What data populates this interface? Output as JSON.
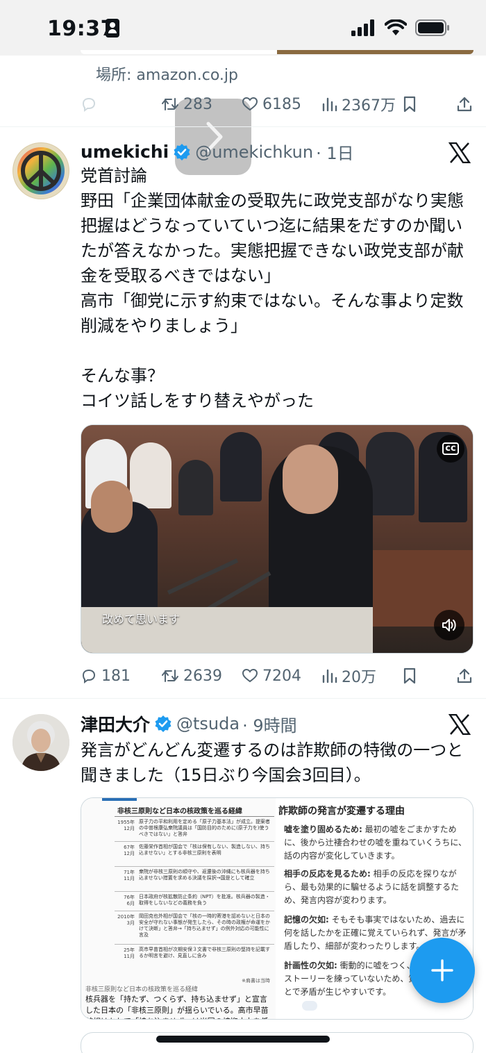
{
  "status_bar": {
    "time": "19:37"
  },
  "previous_tweet": {
    "location": "場所: amazon.co.jp",
    "retweets": "283",
    "likes": "6185",
    "views": "2367万"
  },
  "tweets": [
    {
      "display_name": "umekichi",
      "handle": "@umekichkun",
      "time": "· 1日",
      "text": "党首討論\n野田「企業団体献金の受取先に政党支部がなり実態把握はどうなっていていつ迄に結果をだすのか聞いたが答えなかった。実態把握できない政党支部が献金を受取るべきではない」\n高市「御党に示す約束ではない。そんな事より定数削減をやりましょう」\n\nそんな事？\nコイツ話しをすり替えやがった",
      "video": {
        "caption": "改めて思います",
        "cc_label": "cc"
      },
      "replies": "181",
      "retweets": "2639",
      "likes": "7204",
      "views": "20万"
    },
    {
      "display_name": "津田大介",
      "handle": "@tsuda",
      "time": "· 9時間",
      "text": "発言がどんどん変遷するのは詐欺師の特徴の一つと聞きました（15日ぶり今国会3回目）。",
      "image": {
        "left_title": "非核三原則など日本の核政策を巡る経緯",
        "timeline": [
          {
            "year": "1955年\n12月",
            "event": "原子力の平和利用を定める「原子力基本法」が成立。提案者の中曽根康弘衆院議員は「国防目的のために(原子力を)使うべきではない」と答弁"
          },
          {
            "year": "67年\n12月",
            "event": "佐藤栄作首相が国会で「核は保有しない、製造しない、持ち込ませない」とする非核三原則を表明"
          },
          {
            "year": "71年\n11月",
            "event": "衆院が非核三原則の順守や、返還後の沖縄にも核兵器を持ち込ませない措置を求める決議を採択→国是として確立"
          },
          {
            "year": "76年\n6月",
            "event": "日本政府が核拡散防止条約（NPT）を批准。核兵器の製造・取得をしないなどの義務を負う"
          },
          {
            "year": "2010年\n3月",
            "event": "岡田克也外相が国会で「核の一時的寄港を認めないと日本の安全が守れない事態が発生したら、その時の政権が命運をかけて決断」と答弁→「持ち込ませず」の例外対応の可能性に言及"
          },
          {
            "year": "25年\n11月",
            "event": "高市早苗首相が次期安保３文書で非核三原則の堅持を記載するか明言を避け、見直しに含み"
          }
        ],
        "note": "※肩書は当時",
        "caption": "非核三原則など日本の核政策を巡る経緯",
        "body": "核兵器を「持たず、つくらず、持ち込ませず」と宣言した日本の「非核三原則」が揺らいでいる。高市早苗首相はかねて「持ち込ませず」は米国の核抑止力を低下させるとして見直しを主張し",
        "right_title": "詐欺師の発言が変遷する理由",
        "reasons": [
          {
            "heading": "嘘を塗り固めるため:",
            "text": " 最初の嘘をごまかすために、後から辻褄合わせの嘘を重ねていくうちに、話の内容が変化していきます。"
          },
          {
            "heading": "相手の反応を見るため:",
            "text": " 相手の反応を探りながら、最も効果的に騙せるように話を調整するため、発言内容が変わります。"
          },
          {
            "heading": "記憶の欠如:",
            "text": " そもそも事実ではないため、過去に何を話したかを正確に覚えていられず、発言が矛盾したり、細部が変わったりします。"
          },
          {
            "heading": "計画性の欠如:",
            "text": " 衝動的に嘘をつく、事前に綿密なストーリーを練っていないため、質問を重ねることで矛盾が生じやすいです。"
          }
        ]
      }
    }
  ],
  "icons": [
    "reply-icon",
    "retweet-icon",
    "like-icon",
    "views-icon",
    "bookmark-icon",
    "share-icon",
    "verified-icon",
    "x-logo-icon",
    "compose-icon"
  ],
  "colors": {
    "accent": "#1d9bf0",
    "text": "#0f1419",
    "secondary": "#536471"
  }
}
